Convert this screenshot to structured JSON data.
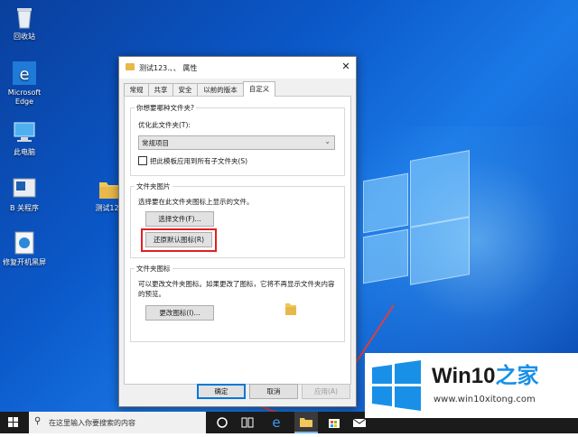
{
  "desktop": {
    "icons": [
      {
        "label": "回收站",
        "icon": "recycle-bin-icon"
      },
      {
        "label": "Microsoft Edge",
        "icon": "edge-icon"
      },
      {
        "label": "此电脑",
        "icon": "computer-icon"
      },
      {
        "label": "B 关程序",
        "icon": "shortcut-icon"
      },
      {
        "label": "修复开机黑屏",
        "icon": "repair-icon"
      },
      {
        "label": "测试123",
        "icon": "folder-icon"
      }
    ]
  },
  "dialog": {
    "title": "测试123.、、  属性",
    "tabs": [
      "常规",
      "共享",
      "安全",
      "以前的版本",
      "自定义"
    ],
    "active_tab": "自定义",
    "section1": {
      "title": "你想要哪种文件夹?",
      "optimize_label": "优化此文件夹(T):",
      "optimize_value": "常规项目",
      "apply_checkbox_label": "把此模板应用到所有子文件夹(S)"
    },
    "section2": {
      "title": "文件夹图片",
      "description": "选择要在此文件夹图标上显示的文件。",
      "choose_file_button": "选择文件(F)...",
      "restore_default_button": "还原默认图标(R)"
    },
    "section3": {
      "title": "文件夹图标",
      "description_line1": "可以更改文件夹图标。如果更改了图标，它将不再显示文件夹内容",
      "description_line2": "的预览。",
      "change_icon_button": "更改图标(I)..."
    },
    "buttons": {
      "ok": "确定",
      "cancel": "取消",
      "apply": "应用(A)"
    }
  },
  "taskbar": {
    "search_placeholder": "在这里输入你要搜索的内容"
  },
  "watermark": {
    "brand_prefix": "Win10",
    "brand_suffix": "之家",
    "url": "www.win10xitong.com"
  },
  "colors": {
    "desktop_blue": "#0b58c9",
    "highlight_red": "#e02020",
    "arrow_red": "#d94040",
    "default_button_border": "#0078d7"
  }
}
